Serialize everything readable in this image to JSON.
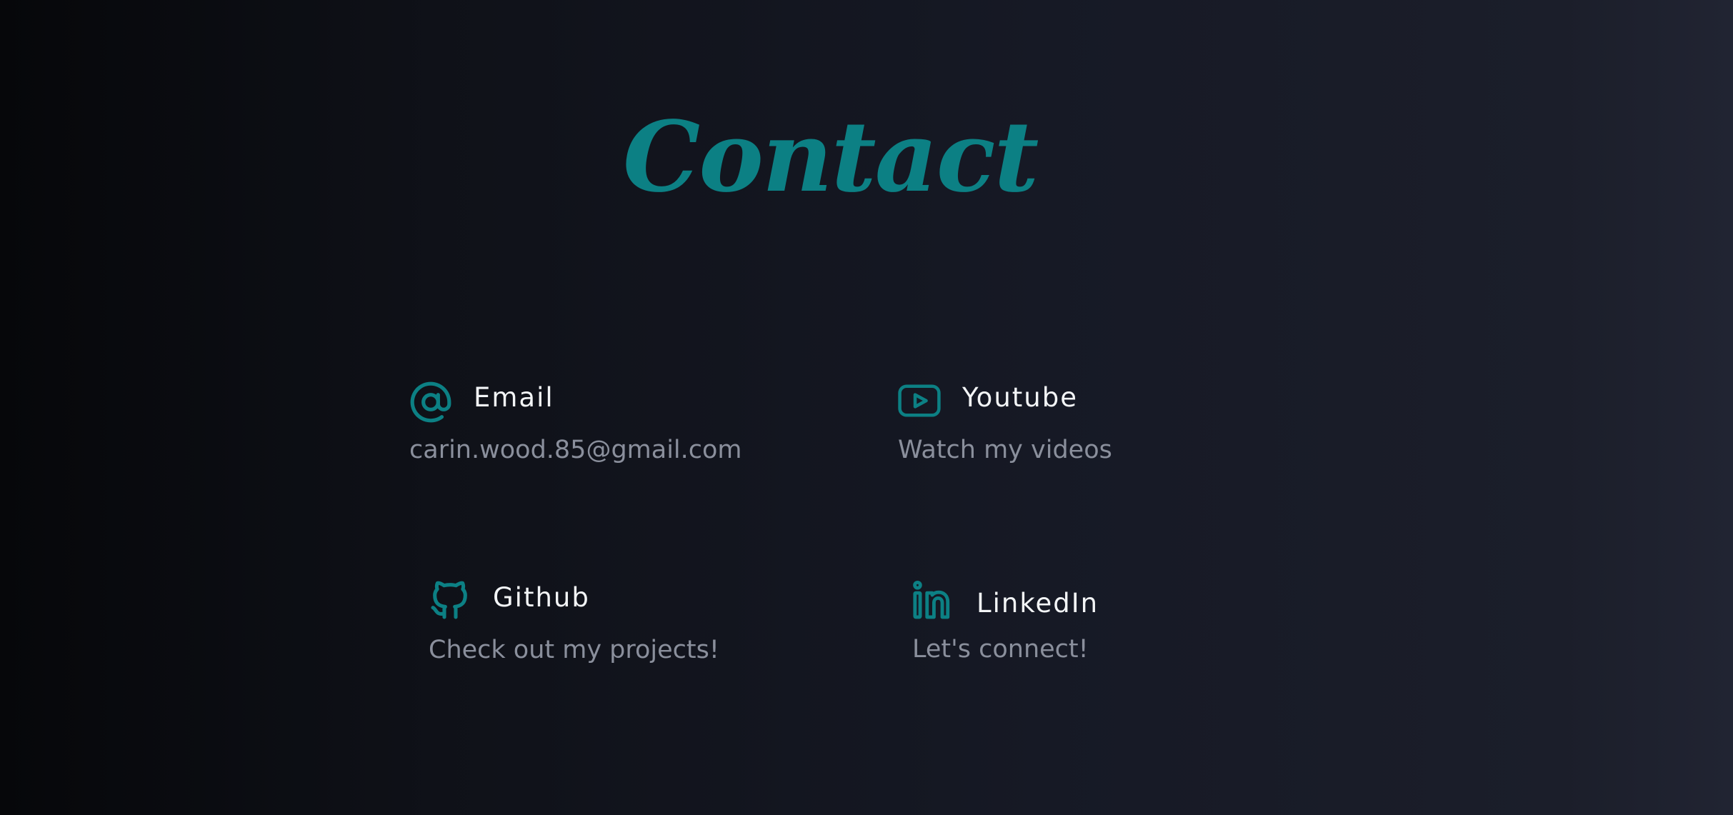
{
  "page": {
    "title": "Contact",
    "accent_color": "#0c8084"
  },
  "contacts": [
    {
      "icon": "at-sign-icon",
      "title": "Email",
      "subtitle": "carin.wood.85@gmail.com"
    },
    {
      "icon": "youtube-icon",
      "title": "Youtube",
      "subtitle": "Watch my videos"
    },
    {
      "icon": "github-icon",
      "title": "Github",
      "subtitle": "Check out my projects!"
    },
    {
      "icon": "linkedin-icon",
      "title": "LinkedIn",
      "subtitle": "Let's connect!"
    }
  ]
}
